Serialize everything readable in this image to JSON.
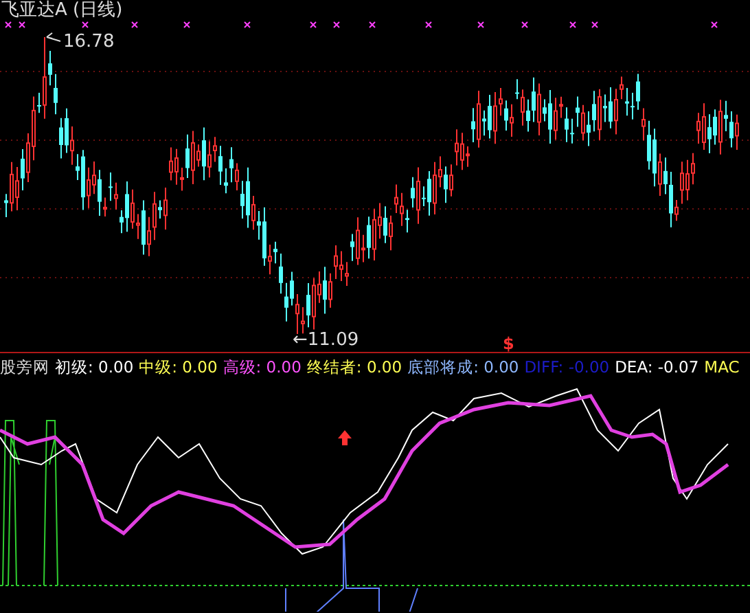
{
  "window": {
    "title": "飞亚达A (日线)"
  },
  "price_chart": {
    "high_label": "16.78",
    "low_label": "←11.09",
    "signal_mark": "$"
  },
  "indicator": {
    "name": "股旁网",
    "legend": [
      {
        "label": "初级: 0.00",
        "color": "#ffffff"
      },
      {
        "label": "中级: 0.00",
        "color": "#ffff54"
      },
      {
        "label": "高级: 0.00",
        "color": "#ff54ff"
      },
      {
        "label": "终结者: 0.00",
        "color": "#ffff54"
      },
      {
        "label": "底部将成: 0.00",
        "color": "#8fb8ff"
      },
      {
        "label": "DIFF: -0.00",
        "color": "#1c1cc8"
      },
      {
        "label": "DEA: -0.07",
        "color": "#ffffff"
      },
      {
        "label": "MAC",
        "color": "#ffff54"
      }
    ]
  }
}
